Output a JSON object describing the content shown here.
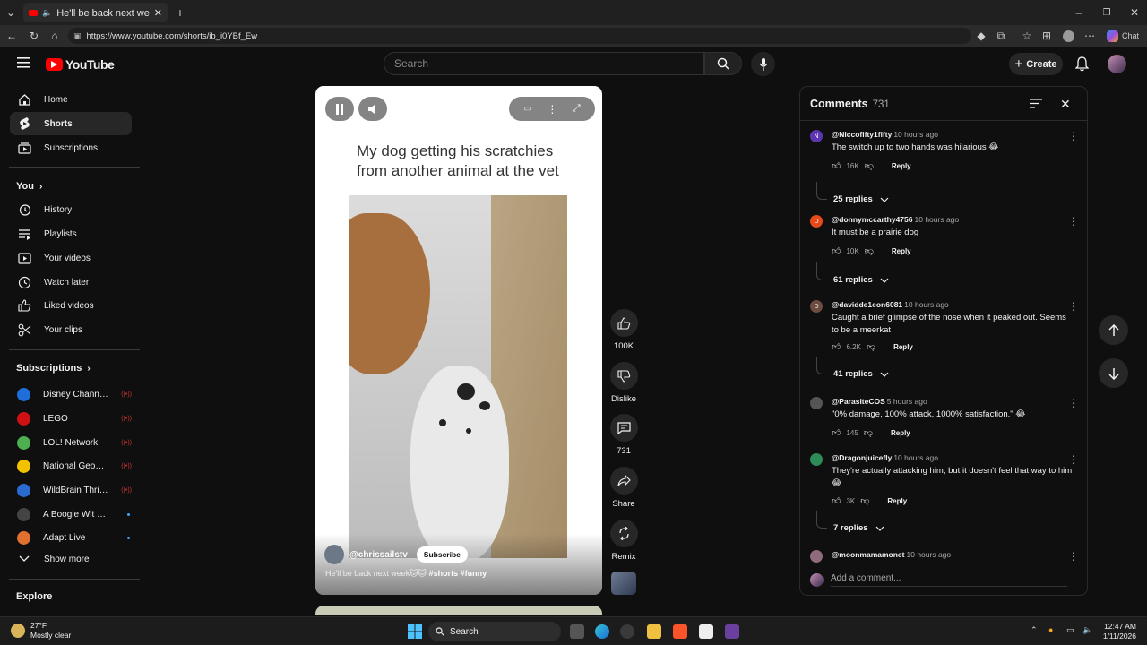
{
  "browser": {
    "tab_title": "He'll be back next week🐱🐱",
    "url": "https://www.youtube.com/shorts/ib_i0YBf_Ew"
  },
  "header": {
    "logo_text": "YouTube",
    "search_placeholder": "Search",
    "create_label": "Create"
  },
  "sidebar": {
    "main": [
      {
        "label": "Home",
        "icon": "home-icon"
      },
      {
        "label": "Shorts",
        "icon": "shorts-icon"
      },
      {
        "label": "Subscriptions",
        "icon": "subscriptions-icon"
      }
    ],
    "you_heading": "You",
    "you": [
      {
        "label": "History",
        "icon": "history-icon"
      },
      {
        "label": "Playlists",
        "icon": "playlists-icon"
      },
      {
        "label": "Your videos",
        "icon": "your-videos-icon"
      },
      {
        "label": "Watch later",
        "icon": "watch-later-icon"
      },
      {
        "label": "Liked videos",
        "icon": "liked-icon"
      },
      {
        "label": "Your clips",
        "icon": "clips-icon"
      }
    ],
    "subscriptions_heading": "Subscriptions",
    "subscriptions": [
      {
        "name": "Disney Channel ...",
        "indicator": "live",
        "color": "#1e6fd9"
      },
      {
        "name": "LEGO",
        "indicator": "live",
        "color": "#d01012"
      },
      {
        "name": "LOL! Network",
        "indicator": "live",
        "color": "#4caf50"
      },
      {
        "name": "National Geogra...",
        "indicator": "live",
        "color": "#f2c200"
      },
      {
        "name": "WildBrain Thrill P...",
        "indicator": "live",
        "color": "#2a6bd1"
      },
      {
        "name": "A Boogie Wit da ...",
        "indicator": "dot",
        "color": "#444444"
      },
      {
        "name": "Adapt Live",
        "indicator": "dot",
        "color": "#e07030"
      }
    ],
    "show_more": "Show more",
    "explore_heading": "Explore"
  },
  "short": {
    "caption": "My dog getting his scratchies from another animal at the vet",
    "channel": "@chrissailstv",
    "subscribe_label": "Subscribe",
    "description": "He'll be back next week🐱🐱",
    "hashtags": "#shorts #funny"
  },
  "actions": {
    "like_count": "100K",
    "dislike_label": "Dislike",
    "comment_count": "731",
    "share_label": "Share",
    "remix_label": "Remix"
  },
  "comments": {
    "title": "Comments",
    "count": "731",
    "add_placeholder": "Add a comment...",
    "items": [
      {
        "author": "@Niccofifty1fifty",
        "time": "10 hours ago",
        "text": "The switch up to two hands was hilarious 😂",
        "likes": "16K",
        "replies": "25 replies",
        "avatar_letter": "N",
        "avatar_color": "#5e35b1"
      },
      {
        "author": "@donnymccarthy4756",
        "time": "10 hours ago",
        "text": "It must be a prairie dog",
        "likes": "10K",
        "replies": "61 replies",
        "avatar_letter": "D",
        "avatar_color": "#e64a19"
      },
      {
        "author": "@davidde1eon6081",
        "time": "10 hours ago",
        "text": "Caught a brief glimpse of the nose when it peaked out. Seems to be a meerkat",
        "likes": "6.2K",
        "replies": "41 replies",
        "avatar_letter": "D",
        "avatar_color": "#6d4c41"
      },
      {
        "author": "@ParasiteCOS",
        "time": "5 hours ago",
        "text": "\"0% damage, 100% attack, 1000% satisfaction.\" 😂",
        "likes": "145",
        "replies": "",
        "avatar_letter": "",
        "avatar_color": "#555555"
      },
      {
        "author": "@Dragonjuicefly",
        "time": "10 hours ago",
        "text": "They're actually attacking him, but it doesn't feel that way to him 😂",
        "likes": "3K",
        "replies": "7 replies",
        "avatar_letter": "",
        "avatar_color": "#2e8b57"
      },
      {
        "author": "@moonmamamonet",
        "time": "10 hours ago",
        "text": "",
        "likes": "",
        "replies": "",
        "avatar_letter": "",
        "avatar_color": "#8e6b7e"
      }
    ],
    "reply_label": "Reply"
  },
  "taskbar": {
    "temperature": "27°F",
    "weather": "Mostly clear",
    "search_label": "Search",
    "time": "12:47 AM",
    "date": "1/11/2026"
  },
  "window": {
    "chat_label": "Chat"
  }
}
